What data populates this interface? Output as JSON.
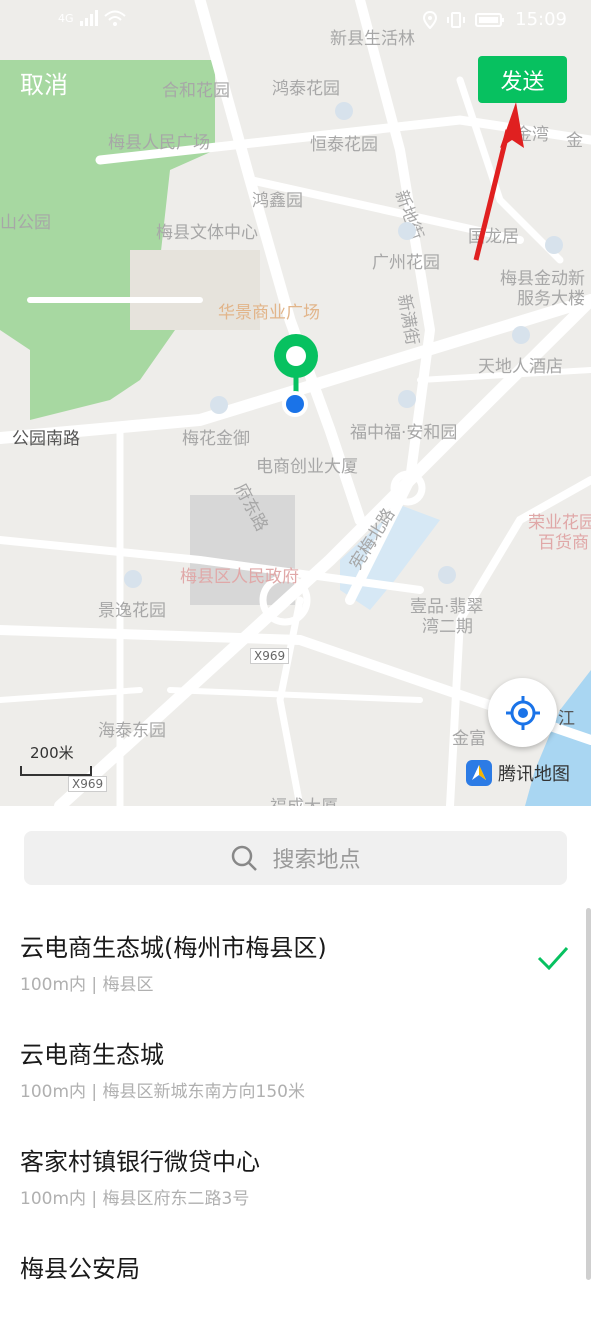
{
  "status_bar": {
    "network": "4G",
    "time": "15:09"
  },
  "header": {
    "cancel_label": "取消",
    "send_label": "发送"
  },
  "map": {
    "labels": [
      "新县生活林",
      "合和花园",
      "鸿泰花园",
      "梅县人民广场",
      "恒泰花园",
      "金湾",
      "金",
      "山公园",
      "鸿鑫园",
      "梅县文体中心",
      "新地街",
      "国龙居",
      "广州花园",
      "梅县金动新",
      "服务大楼",
      "华景商业广场",
      "新满街",
      "天地人酒店",
      "公园南路",
      "梅花金御",
      "福中福·安和园",
      "电商创业大厦",
      "府东路",
      "宪梅北路",
      "梅县区人民政府",
      "荣业花园",
      "百货商",
      "景逸花园",
      "壹品·翡翠",
      "湾二期",
      "X969",
      "海泰东园",
      "金富",
      "江",
      "X969",
      "福成大厦"
    ],
    "scale_label": "200米",
    "provider": "腾讯地图",
    "colors": {
      "water": "#a9d6f2",
      "park": "#a7d8a1",
      "road": "#ffffff",
      "base": "#eeedea",
      "pin": "#07c160",
      "dot": "#1a73e8"
    }
  },
  "search": {
    "placeholder": "搜索地点"
  },
  "results": [
    {
      "title": "云电商生态城(梅州市梅县区)",
      "subtitle": "100m内 | 梅县区",
      "selected": true
    },
    {
      "title": "云电商生态城",
      "subtitle": "100m内 | 梅县区新城东南方向150米",
      "selected": false
    },
    {
      "title": "客家村镇银行微贷中心",
      "subtitle": "100m内 | 梅县区府东二路3号",
      "selected": false
    },
    {
      "title": "梅县公安局",
      "subtitle": "",
      "selected": false
    }
  ]
}
